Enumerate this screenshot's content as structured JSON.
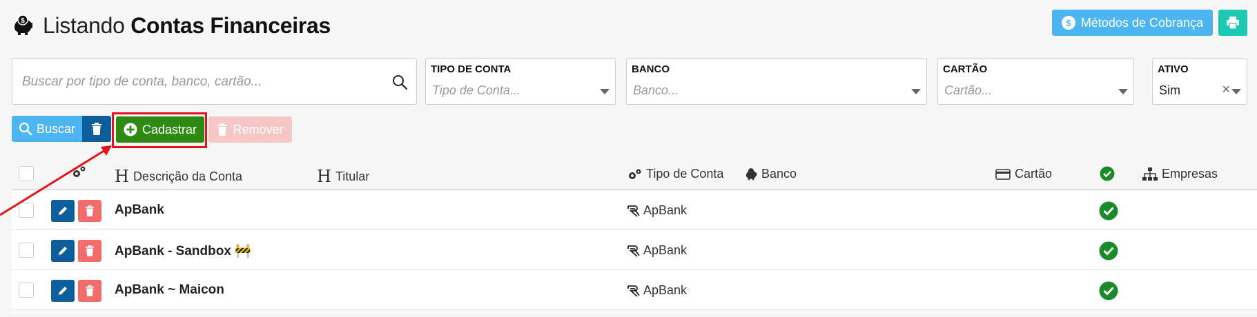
{
  "header": {
    "title_light": "Listando",
    "title_bold": "Contas Financeiras",
    "icon": "piggy-bank-icon"
  },
  "top_actions": {
    "metodos_label": "Métodos de Cobrança",
    "print_icon": "print-icon"
  },
  "filters": {
    "search_placeholder": "Buscar por tipo de conta, banco, cartão...",
    "tipo_conta": {
      "label": "TIPO DE CONTA",
      "placeholder": "Tipo de Conta..."
    },
    "banco": {
      "label": "BANCO",
      "placeholder": "Banco..."
    },
    "cartao": {
      "label": "CARTÃO",
      "placeholder": "Cartão..."
    },
    "ativo": {
      "label": "ATIVO",
      "value": "Sim",
      "clear": "×"
    }
  },
  "actions": {
    "buscar": "Buscar",
    "cadastrar": "Cadastrar",
    "remover": "Remover"
  },
  "table": {
    "columns": {
      "descricao": "Descrição da Conta",
      "titular": "Titular",
      "tipo": "Tipo de Conta",
      "banco": "Banco",
      "cartao": "Cartão",
      "empresas": "Empresas"
    },
    "rows": [
      {
        "descricao": "ApBank",
        "tipo": "ApBank",
        "ativo": true
      },
      {
        "descricao": "ApBank - Sandbox 🚧",
        "tipo": "ApBank",
        "ativo": true
      },
      {
        "descricao": "ApBank ~ Maicon",
        "tipo": "ApBank",
        "ativo": true
      }
    ]
  },
  "colors": {
    "primary_blue": "#4db6f2",
    "dark_blue": "#0f5e9c",
    "success_green": "#2e8a12",
    "danger_red": "#f26c6c",
    "highlight_red": "#e8101a",
    "teal": "#1ec9b4"
  }
}
